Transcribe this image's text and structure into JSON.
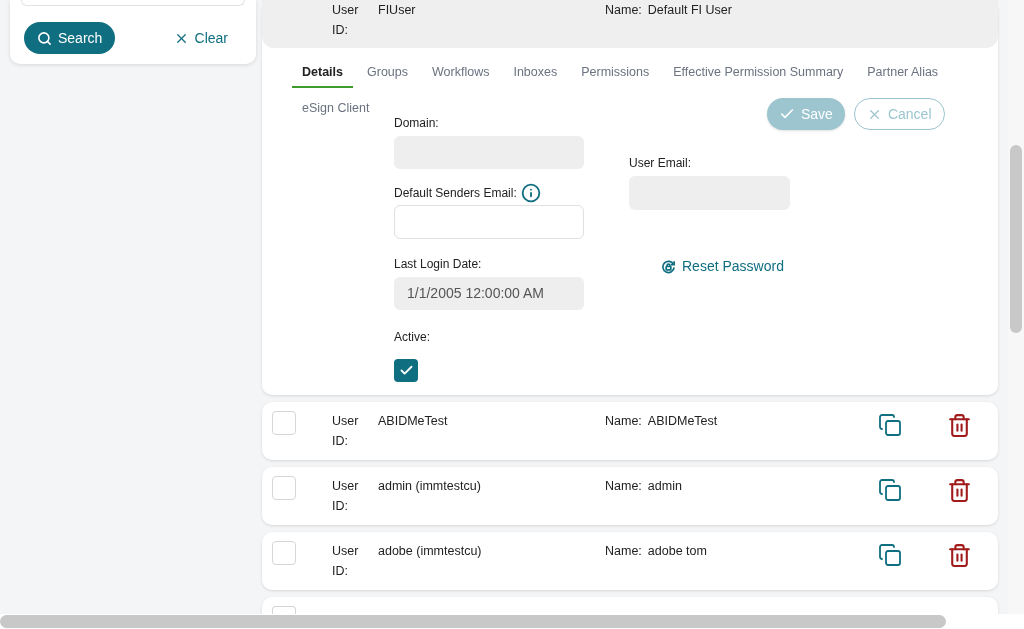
{
  "search_panel": {
    "buttons": [
      {
        "kind": "search",
        "label": "Search"
      },
      {
        "kind": "clear",
        "label": "Clear"
      }
    ]
  },
  "selected_user": {
    "user_id_label": "User ID:",
    "user_id": "FIUser",
    "name_label": "Name:",
    "name": "Default FI User"
  },
  "tabs": [
    {
      "label": "Details",
      "selected": true
    },
    {
      "label": "Groups",
      "selected": false
    },
    {
      "label": "Workflows",
      "selected": false
    },
    {
      "label": "Inboxes",
      "selected": false
    },
    {
      "label": "Permissions",
      "selected": false
    },
    {
      "label": "Effective Permission Summary",
      "selected": false
    },
    {
      "label": "Partner Alias",
      "selected": false
    },
    {
      "label": "eSign Client",
      "selected": false
    }
  ],
  "form": {
    "domain": {
      "label": "Domain:"
    },
    "senders_email": {
      "label": "Default Senders Email:"
    },
    "last_login": {
      "label": "Last Login Date:",
      "value": "1/1/2005 12:00:00 AM"
    },
    "active": {
      "label": "Active:",
      "checked": true
    },
    "user_email": {
      "label": "User Email:"
    },
    "actions": [
      {
        "kind": "save",
        "label": "Save",
        "disabled": true
      },
      {
        "kind": "cancel",
        "label": "Cancel",
        "disabled": true
      }
    ],
    "reset_link": "Reset Password"
  },
  "users": [
    {
      "user_id_label": "User ID:",
      "user_id": "ABIDMeTest",
      "name_label": "Name:",
      "name": "ABIDMeTest",
      "checked": false
    },
    {
      "user_id_label": "User ID:",
      "user_id": "admin (immtestcu)",
      "name_label": "Name:",
      "name": "admin",
      "checked": false
    },
    {
      "user_id_label": "User ID:",
      "user_id": "adobe (immtestcu)",
      "name_label": "Name:",
      "name": "adobe tom",
      "checked": false
    }
  ],
  "partial_row": {
    "checked": false
  }
}
